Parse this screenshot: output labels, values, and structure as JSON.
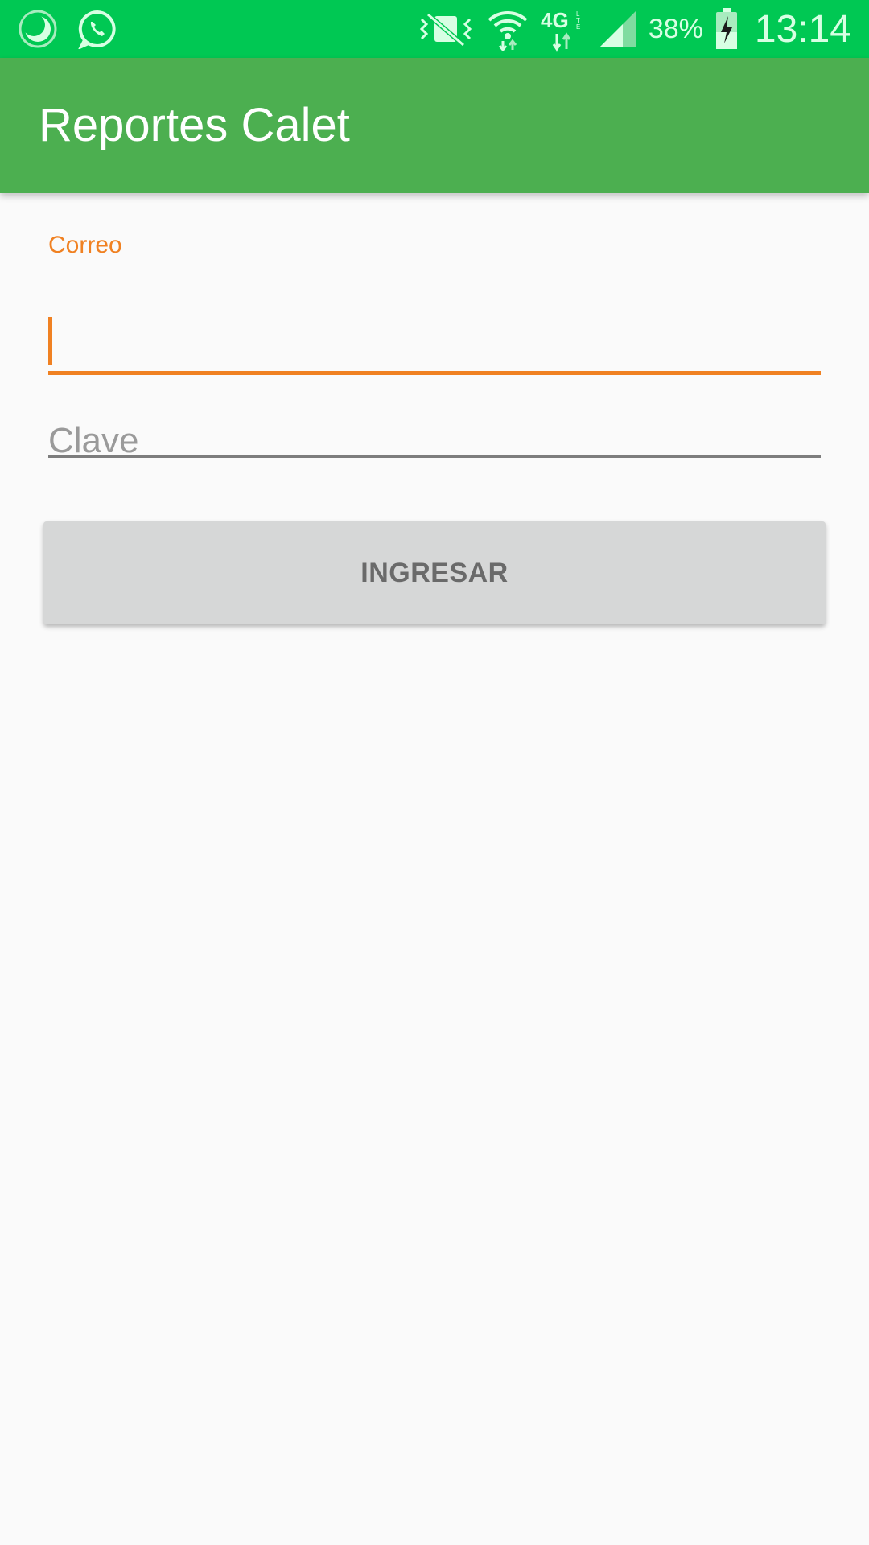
{
  "status_bar": {
    "left_icons": [
      "night-mode-icon",
      "whatsapp-icon"
    ],
    "right_icons": [
      "vibrate-mute-icon",
      "wifi-icon",
      "4g-lte-icon",
      "cell-signal-icon",
      "battery-charging-icon"
    ],
    "battery_percent": "38%",
    "time": "13:14",
    "colors": {
      "background": "#00c853",
      "foreground": "#d7ffe3"
    }
  },
  "app_bar": {
    "title": "Reportes Calet",
    "color": "#4caf50"
  },
  "form": {
    "email": {
      "label": "Correo",
      "value": "",
      "accent": "#f08122"
    },
    "password": {
      "placeholder": "Clave",
      "value": ""
    },
    "submit_label": "INGRESAR"
  }
}
